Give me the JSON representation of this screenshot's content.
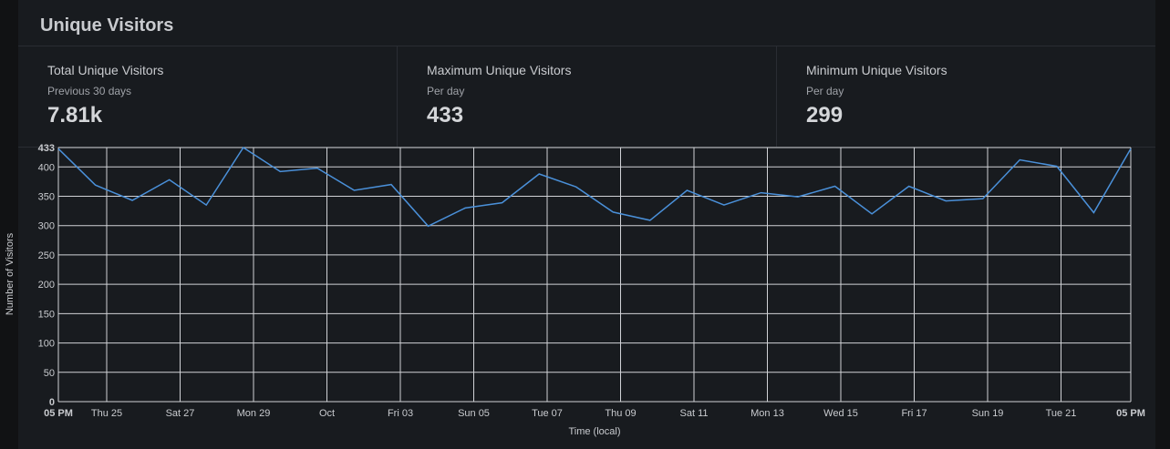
{
  "panel": {
    "title": "Unique Visitors"
  },
  "stats": [
    {
      "label": "Total Unique Visitors",
      "sub": "Previous 30 days",
      "value": "7.81k"
    },
    {
      "label": "Maximum Unique Visitors",
      "sub": "Per day",
      "value": "433"
    },
    {
      "label": "Minimum Unique Visitors",
      "sub": "Per day",
      "value": "299"
    }
  ],
  "chart_data": {
    "type": "line",
    "xlabel": "Time (local)",
    "ylabel": "Number of Visitors",
    "ylim": [
      0,
      433
    ],
    "y_ticks": [
      0,
      50,
      100,
      150,
      200,
      250,
      300,
      350,
      400,
      433
    ],
    "x_ticks": [
      "05 PM",
      "Thu 25",
      "Sat 27",
      "Mon 29",
      "Oct",
      "Fri 03",
      "Sun 05",
      "Tue 07",
      "Thu 09",
      "Sat 11",
      "Mon 13",
      "Wed 15",
      "Fri 17",
      "Sun 19",
      "Tue 21",
      "05 PM"
    ],
    "grid": true,
    "color": "#4a90d9",
    "series": [
      {
        "values": [
          431,
          369,
          343,
          378,
          335,
          433,
          392,
          398,
          360,
          370,
          299,
          330,
          339,
          388,
          366,
          323,
          309,
          360,
          335,
          356,
          349,
          367,
          320,
          367,
          342,
          346,
          412,
          401,
          322,
          431
        ]
      }
    ]
  }
}
